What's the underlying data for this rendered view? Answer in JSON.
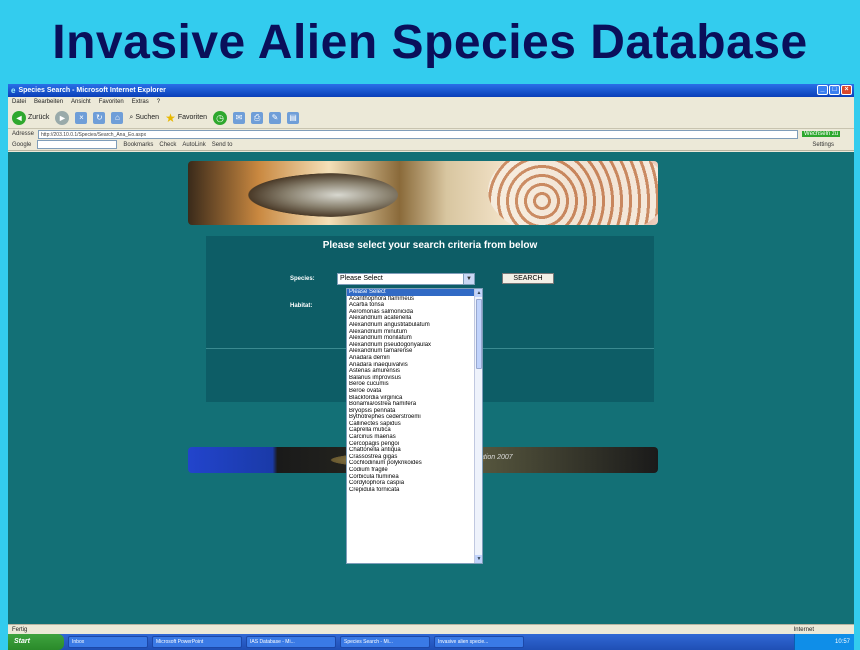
{
  "slide": {
    "title": "Invasive Alien Species Database"
  },
  "browser": {
    "window_title": "Species Search - Microsoft Internet Explorer",
    "menu": [
      "Datei",
      "Bearbeiten",
      "Ansicht",
      "Favoriten",
      "Extras",
      "?"
    ],
    "address_label": "Adresse",
    "address_url": "http://203.10.0.1/Species/Search_Ana_Eo.aspx",
    "go_label": "Wechseln zu",
    "google_label": "Google",
    "toolbar": {
      "back_label": "Zurück",
      "search_label": "Suchen",
      "favorites_label": "Favoriten",
      "bookmarks_label": "Bookmarks",
      "check_label": "Check",
      "autolink_label": "AutoLink",
      "sendto_label": "Send to",
      "settings_label": "Settings"
    },
    "status_text": "Fertig",
    "status_zone": "Internet"
  },
  "page": {
    "heading": "Please select your search criteria from below",
    "species_label": "Species:",
    "habitat_label": "Habitat:",
    "species_selected": "Please Select",
    "search_button": "SEARCH",
    "footer_banner_text": "ation 2007",
    "species_options": [
      "Please Select",
      "Acanthophora flammeus",
      "Acartia tonsa",
      "Aeromonas salmonicida",
      "Alexandrium acatenella",
      "Alexandrium angustitabulatum",
      "Alexandrium minutum",
      "Alexandrium monilatum",
      "Alexandrium pseudogonyaulax",
      "Alexandrium tamarense",
      "Anadara demiri",
      "Anadara inaequivalvis",
      "Asterias amurensis",
      "Balanus improvisus",
      "Beroe cucumis",
      "Beroe ovata",
      "Blackfordia virginica",
      "Bonamia/ostrea hamifera",
      "Bryopsis pennata",
      "Bythotrephes cederstroemi",
      "Callinectes sapidus",
      "Caprella mutica",
      "Carcinus maenas",
      "Cercopagis pengoi",
      "Chattonella antiqua",
      "Crassostrea gigas",
      "Cochlodinium polykrikoides",
      "Codium fragile",
      "Corbicula fluminea",
      "Cordylophora caspia",
      "Crepidula fornicata"
    ]
  },
  "taskbar": {
    "start_label": "Start",
    "tasks": [
      "Inbox",
      "Microsoft PowerPoint",
      "IAS Database - Mi...",
      "Species Search - Mi...",
      "Invasive alien specie..."
    ],
    "tray_time": "10:57"
  }
}
